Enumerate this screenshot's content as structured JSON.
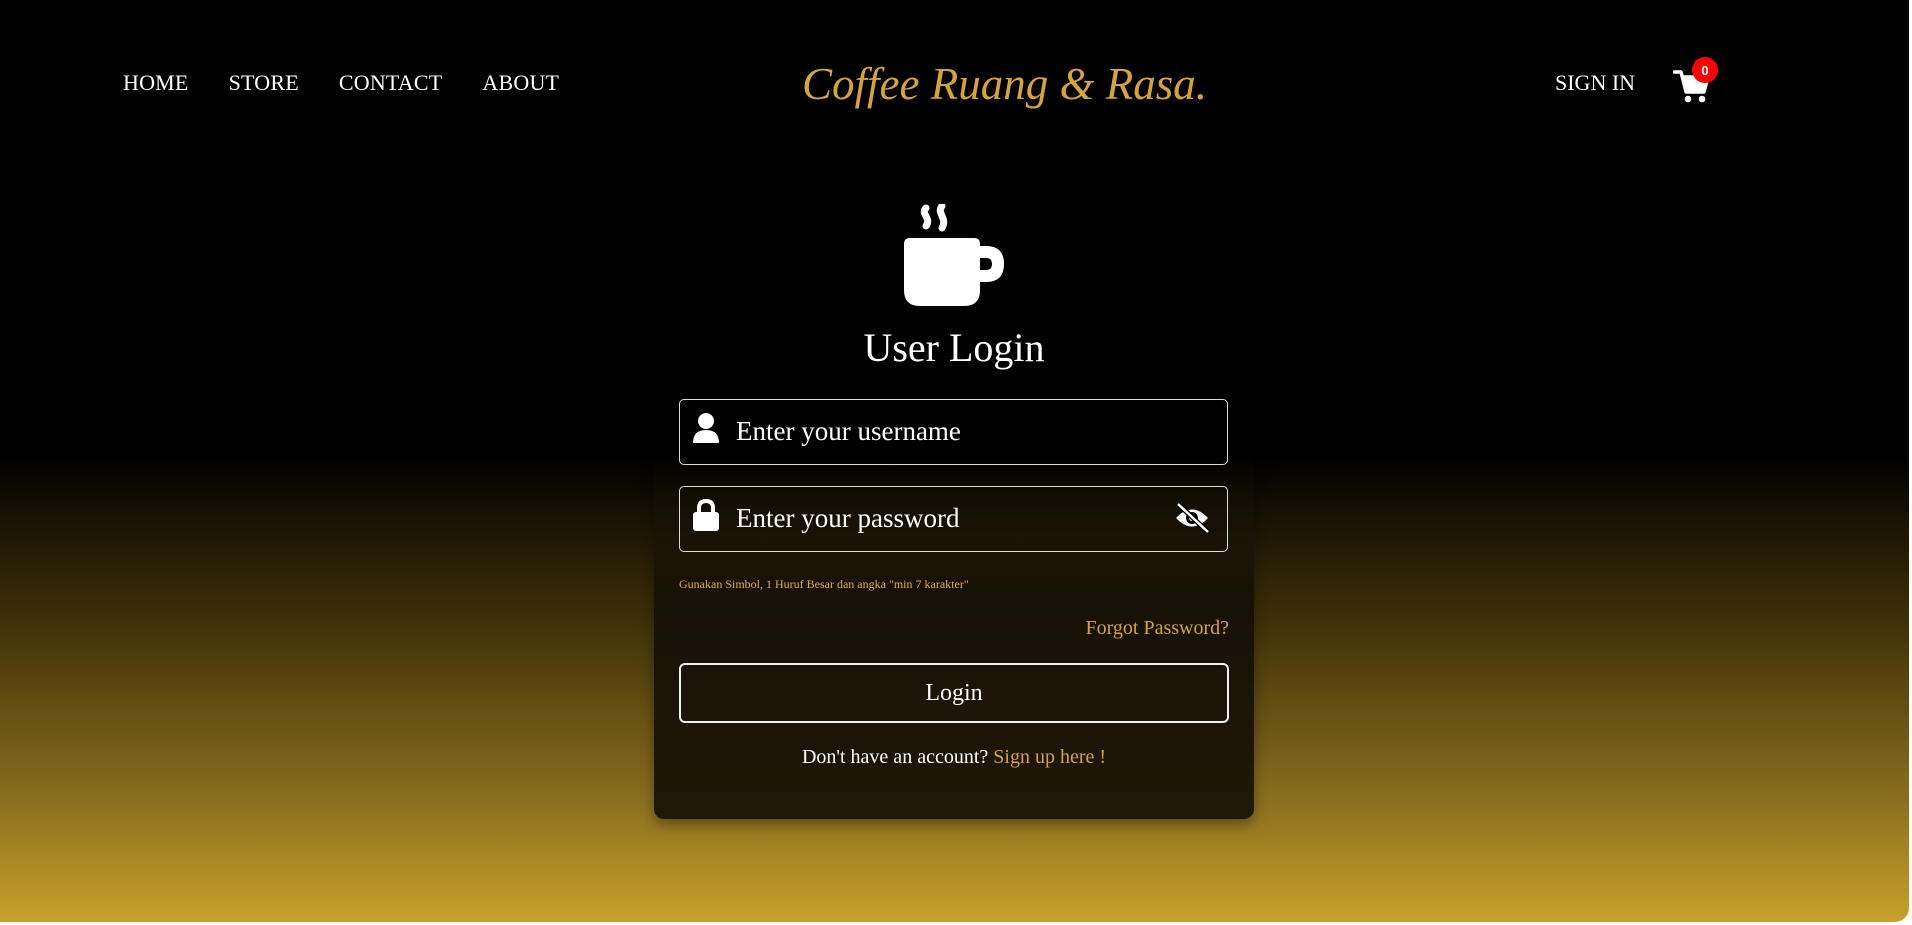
{
  "nav": {
    "links": [
      "HOME",
      "STORE",
      "CONTACT",
      "ABOUT"
    ],
    "brand": "Coffee Ruang & Rasa.",
    "signin": "SIGN IN",
    "cart_count": "0",
    "cart_icon": "cart-icon"
  },
  "login": {
    "icon": "coffee-cup-icon",
    "title": "User Login",
    "username_placeholder": "Enter your username",
    "password_placeholder": "Enter your password",
    "user_icon": "user-icon",
    "lock_icon": "lock-icon",
    "eye_icon": "eye-slash-icon",
    "hint": "Gunakan Simbol, 1 Huruf Besar dan angka \"min 7 karakter\"",
    "forgot": "Forgot Password?",
    "button": "Login",
    "no_account": "Don't have an account?",
    "signup": "Sign up here !"
  },
  "colors": {
    "accent": "#d5a43c",
    "badge": "#ff0000",
    "gradient_bottom": "#c9a12b"
  }
}
